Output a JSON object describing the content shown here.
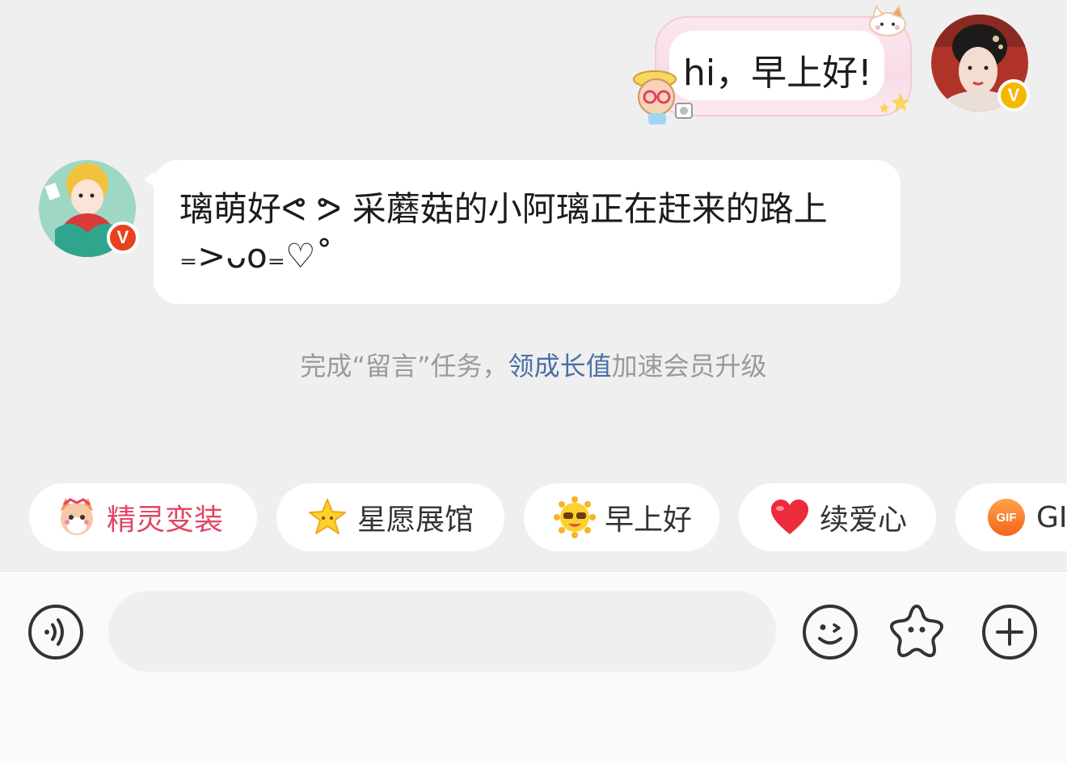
{
  "messages": {
    "outgoing": {
      "text": "hi，早上好!"
    },
    "incoming": {
      "text": "璃萌好ᕙ ᕗ 采蘑菇的小阿璃正在赶来的路上₌>ᴗo₌♡˚"
    }
  },
  "tip": {
    "prefix": "完成“留言”任务，",
    "link": "领成长值",
    "suffix": "加速会员升级"
  },
  "quick_replies": [
    {
      "label": "精灵变装",
      "icon": "fox-sprite-icon"
    },
    {
      "label": "星愿展馆",
      "icon": "star-icon"
    },
    {
      "label": "早上好",
      "icon": "sun-face-icon"
    },
    {
      "label": "续爱心",
      "icon": "heart-icon"
    },
    {
      "label": "GI",
      "icon": "gif-icon"
    }
  ],
  "gif_badge": "GIF",
  "verified_badge": "V",
  "input": {
    "value": "",
    "placeholder": ""
  }
}
